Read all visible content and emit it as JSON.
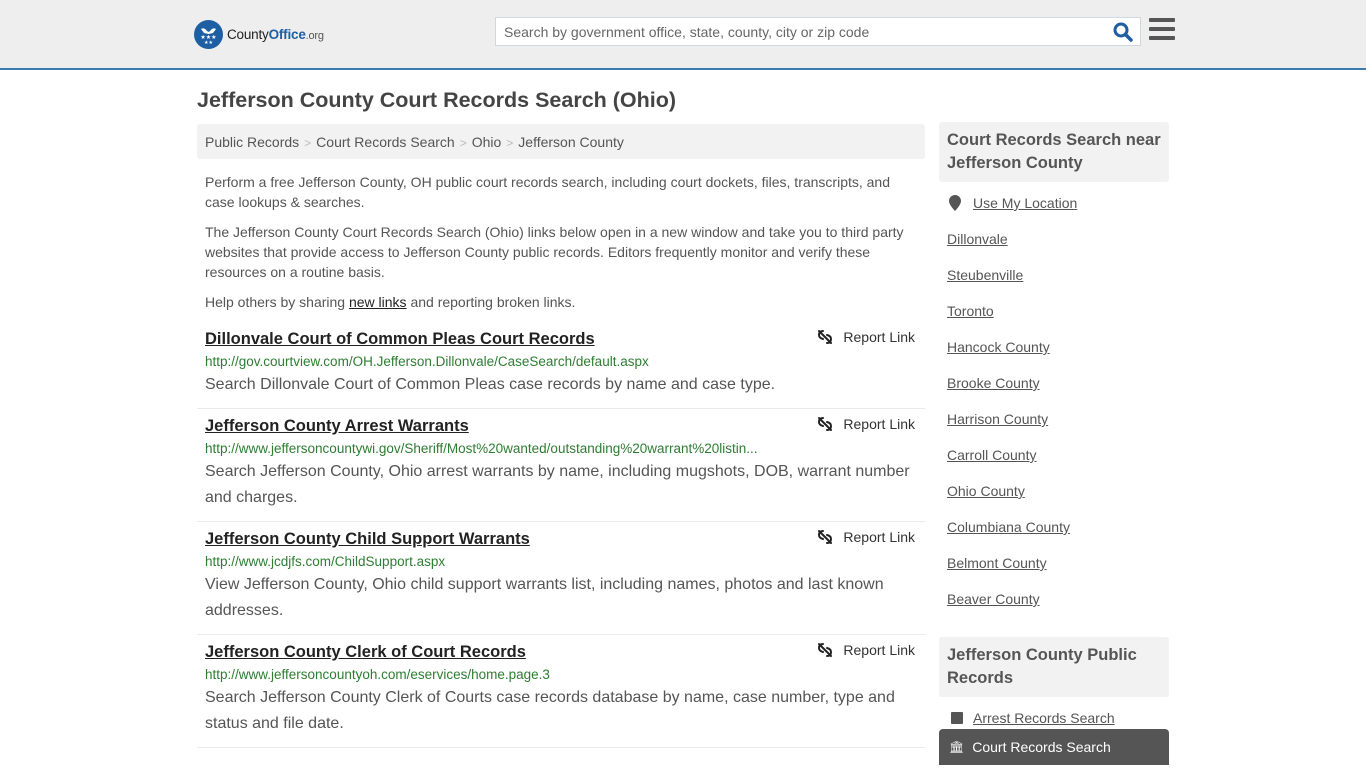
{
  "header": {
    "logo": {
      "county": "County",
      "office": "Office",
      "org": ".org"
    },
    "search": {
      "placeholder": "Search by government office, state, county, city or zip code",
      "value": ""
    },
    "search_icon": "search-icon",
    "menu_icon": "hamburger-menu-icon"
  },
  "page_title": "Jefferson County Court Records Search (Ohio)",
  "breadcrumb": [
    "Public Records",
    "Court Records Search",
    "Ohio",
    "Jefferson County"
  ],
  "breadcrumb_sep": ">",
  "intro": {
    "p1": "Perform a free Jefferson County, OH public court records search, including court dockets, files, transcripts, and case lookups & searches.",
    "p2": "The Jefferson County Court Records Search (Ohio) links below open in a new window and take you to third party websites that provide access to Jefferson County public records. Editors frequently monitor and verify these resources on a routine basis.",
    "p3_before": "Help others by sharing ",
    "p3_link": "new links",
    "p3_after": " and reporting broken links."
  },
  "report_label": "Report Link",
  "results": [
    {
      "title": "Dillonvale Court of Common Pleas Court Records",
      "url": "http://gov.courtview.com/OH.Jefferson.Dillonvale/CaseSearch/default.aspx",
      "desc": "Search Dillonvale Court of Common Pleas case records by name and case type."
    },
    {
      "title": "Jefferson County Arrest Warrants",
      "url": "http://www.jeffersoncountywi.gov/Sheriff/Most%20wanted/outstanding%20warrant%20listin...",
      "desc": "Search Jefferson County, Ohio arrest warrants by name, including mugshots, DOB, warrant number and charges."
    },
    {
      "title": "Jefferson County Child Support Warrants",
      "url": "http://www.jcdjfs.com/ChildSupport.aspx",
      "desc": "View Jefferson County, Ohio child support warrants list, including names, photos and last known addresses."
    },
    {
      "title": "Jefferson County Clerk of Court Records",
      "url": "http://www.jeffersoncountyoh.com/eservices/home.page.3",
      "desc": "Search Jefferson County Clerk of Courts case records database by name, case number, type and status and file date."
    }
  ],
  "sidebar": {
    "nearby_title": "Court Records Search near Jefferson County",
    "use_location": "Use My Location",
    "nearby": [
      "Dillonvale",
      "Steubenville",
      "Toronto",
      "Hancock County",
      "Brooke County",
      "Harrison County",
      "Carroll County",
      "Ohio County",
      "Columbiana County",
      "Belmont County",
      "Beaver County"
    ],
    "public_title": "Jefferson County Public Records",
    "public_items": [
      "Arrest Records Search"
    ],
    "active_item": "Court Records Search"
  },
  "colors": {
    "brand_blue": "#1e5fa3",
    "header_border": "#3a7bb0",
    "url_green": "#2e7d32",
    "active_bg": "#555555"
  }
}
